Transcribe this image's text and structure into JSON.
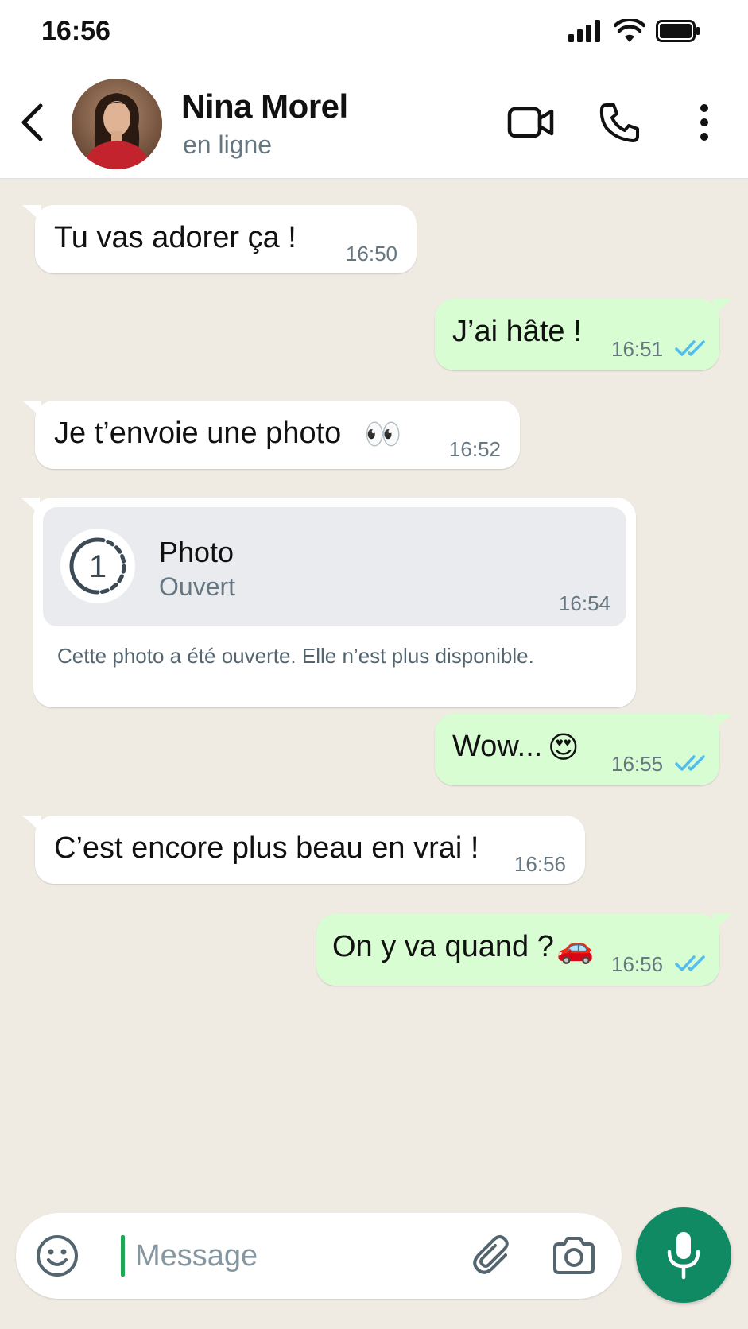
{
  "status_bar": {
    "time": "16:56"
  },
  "header": {
    "name": "Nina Morel",
    "status": "en ligne",
    "icons": [
      "back-arrow-icon",
      "video-call-icon",
      "phone-icon",
      "more-vert-icon"
    ]
  },
  "messages": [
    {
      "dir": "in",
      "text": "Tu vas adorer ça !",
      "time": "16:50"
    },
    {
      "dir": "out",
      "text": "J’ai hâte !",
      "time": "16:51",
      "read": true
    },
    {
      "dir": "in",
      "text": "Je t’envoie une photo",
      "emoji": "👀",
      "time": "16:52"
    },
    {
      "dir": "out",
      "text": "Wow...",
      "emoji": "😍",
      "time": "16:55",
      "read": true
    },
    {
      "dir": "in",
      "text": "C’est encore plus beau en vrai !",
      "time": "16:56"
    },
    {
      "dir": "out",
      "text": "On y va quand ?",
      "emoji": "🚗",
      "time": "16:56",
      "read": true
    }
  ],
  "view_once": {
    "counter": "1",
    "title": "Photo",
    "subtitle": "Ouvert",
    "time": "16:54",
    "note": "Cette photo a été ouverte. Elle n’est plus disponible."
  },
  "composer": {
    "placeholder": "Message",
    "icons": [
      "emoji-icon",
      "attach-icon",
      "camera-icon",
      "mic-icon"
    ]
  },
  "colors": {
    "background": "#efeae2",
    "incoming": "#ffffff",
    "outgoing": "#d9fdd3",
    "read_ticks": "#53bdeb",
    "accent": "#0f8a63"
  }
}
